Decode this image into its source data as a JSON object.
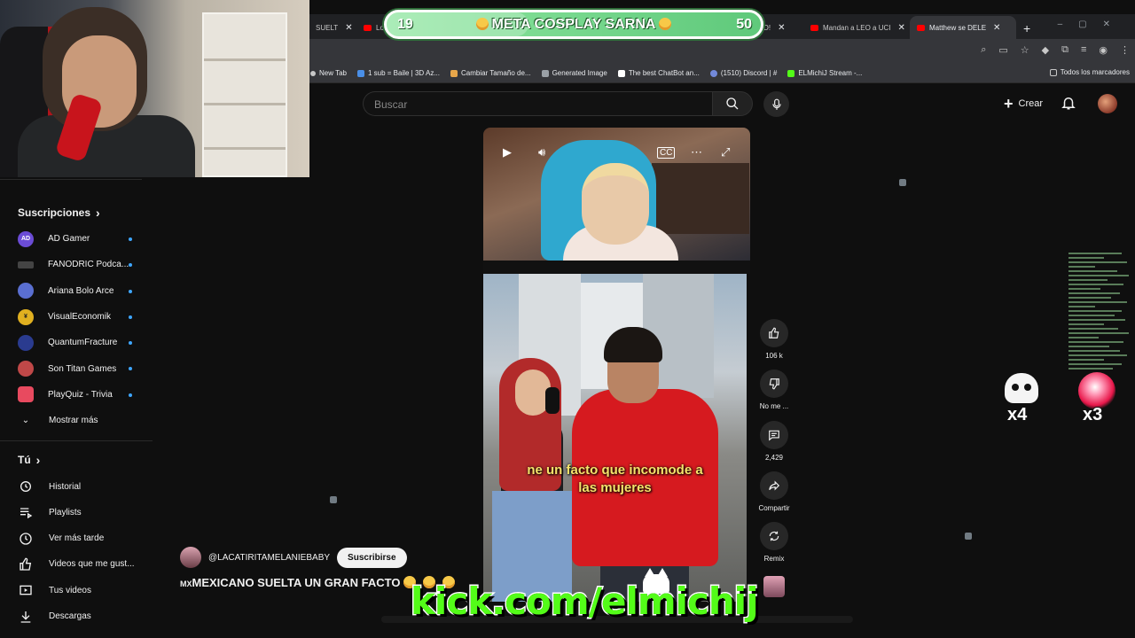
{
  "browser": {
    "tabs": [
      {
        "label": "SUELT",
        "active": false
      },
      {
        "label": "Lo",
        "active": false
      },
      {
        "label": "DIOS MIO!",
        "active": false
      },
      {
        "label": "Mandan a LEO a UCI",
        "active": false
      },
      {
        "label": "Matthew se DELE",
        "active": true
      }
    ],
    "bookmarks": [
      {
        "label": "New Tab",
        "color": "#c8c8c8"
      },
      {
        "label": "1 sub = Baile | 3D Az...",
        "color": "#4a8fe7"
      },
      {
        "label": "Cambiar Tamaño de...",
        "color": "#e7a64a"
      },
      {
        "label": "Generated Image",
        "color": "#9aa0a6"
      },
      {
        "label": "The best ChatBot an...",
        "color": "#ffffff"
      },
      {
        "label": "(1510) Discord | #",
        "color": "#7289da"
      },
      {
        "label": "ELMichiJ Stream -...",
        "color": "#53fc18"
      }
    ],
    "bookmarks_all": "Todos los marcadores"
  },
  "youtube": {
    "search_placeholder": "Buscar",
    "create_label": "Crear",
    "sidebar": {
      "subscriptions_title": "Suscripciones",
      "subscriptions": [
        {
          "name": "AD Gamer",
          "initials": "AD",
          "color": "#6b4cd6"
        },
        {
          "name": "FANODRIC Podca...",
          "initials": "",
          "color": "#444"
        },
        {
          "name": "Ariana Bolo Arce",
          "initials": "",
          "color": "#5a6fd1"
        },
        {
          "name": "VisualEconomik",
          "initials": "¥",
          "color": "#e0b020"
        },
        {
          "name": "QuantumFracture",
          "initials": "",
          "color": "#2a3b8f"
        },
        {
          "name": "Son Titan Games",
          "initials": "",
          "color": "#c04848"
        },
        {
          "name": "PlayQuiz - Trivia",
          "initials": "",
          "color": "#e84a5f"
        }
      ],
      "show_more": "Mostrar más",
      "you_title": "Tú",
      "you_items": [
        {
          "label": "Historial",
          "icon": "history-icon"
        },
        {
          "label": "Playlists",
          "icon": "playlists-icon"
        },
        {
          "label": "Ver más tarde",
          "icon": "watch-later-icon"
        },
        {
          "label": "Videos que me gust...",
          "icon": "like-icon"
        },
        {
          "label": "Tus videos",
          "icon": "your-videos-icon"
        },
        {
          "label": "Descargas",
          "icon": "download-icon"
        }
      ]
    },
    "short": {
      "caption_line1": "ne un facto que incomode a",
      "caption_line2": "las mujeres",
      "channel": "@LACATIRITAMELANIEBABY",
      "subscribe_label": "Suscribirse",
      "title_prefix": "MX",
      "title": "MEXICANO SUELTA UN GRAN FACTO"
    },
    "actions": {
      "likes": "106 k",
      "dislike": "No me ...",
      "comments": "2,429",
      "share": "Compartir",
      "remix": "Remix"
    }
  },
  "overlay": {
    "goal_current": "19",
    "goal_label": "META COSPLAY SARNA",
    "goal_target": "50",
    "goal_progress": 0.38,
    "kick_url": "kick.com/elmichij",
    "skull_multiplier": "x4",
    "orb_multiplier": "x3"
  }
}
